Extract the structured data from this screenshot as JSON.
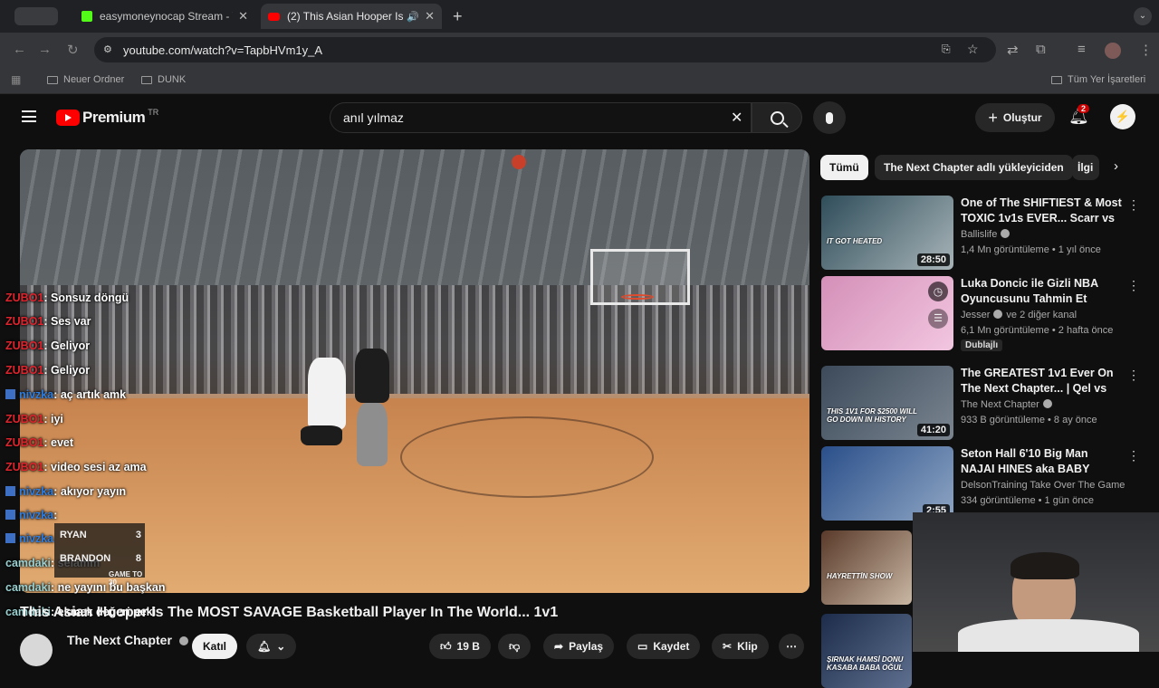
{
  "browser": {
    "tabs": [
      {
        "label": "easymoneynocap Stream - W",
        "icon_color": "#53fc18"
      },
      {
        "label": "(2) This Asian Hooper Is T",
        "icon_color": "#ff0000"
      }
    ],
    "url": "youtube.com/watch?v=TapbHVm1y_A",
    "bookmarks": [
      "Neuer Ordner",
      "DUNK"
    ],
    "all_bookmarks": "Tüm Yer İşaretleri"
  },
  "youtube": {
    "logo": "Premium",
    "logo_region": "TR",
    "search_value": "anıl yılmaz",
    "create_label": "Oluştur",
    "notification_count": "2"
  },
  "chat": [
    {
      "user": "ZUBO1",
      "type": "zubo",
      "text": ": Sonsuz döngü"
    },
    {
      "user": "ZUBO1",
      "type": "zubo",
      "text": ": Ses var"
    },
    {
      "user": "ZUBO1",
      "type": "zubo",
      "text": ": Geliyor"
    },
    {
      "user": "ZUBO1",
      "type": "zubo",
      "text": ": Geliyor"
    },
    {
      "user": "nivzka",
      "type": "niv",
      "text": ": aç artık amk"
    },
    {
      "user": "ZUBO1",
      "type": "zubo",
      "text": ": iyi"
    },
    {
      "user": "ZUBO1",
      "type": "zubo",
      "text": ": evet"
    },
    {
      "user": "ZUBO1",
      "type": "zubo",
      "text": ": video sesi az ama"
    },
    {
      "user": "nivzka",
      "type": "niv",
      "text": ": akıyor yayın"
    },
    {
      "user": "nivzka",
      "type": "niv",
      "text": ":"
    },
    {
      "user": "nivzka",
      "type": "niv",
      "text": ""
    },
    {
      "user": "camdaki",
      "type": "cam",
      "text": ": selamm"
    },
    {
      "user": "camdaki",
      "type": "cam",
      "text": ": ne yayını bu başkan"
    },
    {
      "user": "camdaki",
      "type": "cam",
      "text": ": ekmek değeri peki"
    }
  ],
  "scoreboard": {
    "p1": "RYAN",
    "s1": "3",
    "p2": "BRANDON",
    "s2": "8",
    "label": "GAME TO 30"
  },
  "video": {
    "title": "This Asian Hooper Is The MOST SAVAGE Basketball Player In The World... 1v1",
    "channel": "The Next Chapter",
    "join_label": "Katıl",
    "likes": "19 B",
    "share": "Paylaş",
    "save": "Kaydet",
    "clip": "Klip"
  },
  "chips": [
    "Tümü",
    "The Next Chapter adlı yükleyiciden",
    "İlgi"
  ],
  "recommendations": [
    {
      "title": "One of The SHIFTIEST & Most TOXIC 1v1s EVER... Scarr vs ...",
      "channel": "Ballislife",
      "meta": "1,4 Mn görüntüleme • 1 yıl önce",
      "duration": "28:50",
      "thumb_text": "IT GOT HEATED",
      "c1": "#2f4d5a",
      "c2": "#a7b4b8"
    },
    {
      "title": "Luka Doncic ile Gizli NBA Oyuncusunu Tahmin Et",
      "channel": "Jesser",
      "channel_extra": "ve 2 diğer kanal",
      "meta": "6,1 Mn görüntüleme • 2 hafta önce",
      "badge": "Dublajlı",
      "duration": "",
      "thumb_text": "",
      "c1": "#d48fb8",
      "c2": "#f2c6e0"
    },
    {
      "title": "The GREATEST 1v1 Ever On The Next Chapter... | Qel vs Patt Fo...",
      "channel": "The Next Chapter",
      "meta": "933 B görüntüleme • 8 ay önce",
      "duration": "41:20",
      "thumb_text": "THIS 1V1 FOR $2500 WILL GO DOWN IN HISTORY",
      "c1": "#3c4a5a",
      "c2": "#7a8590"
    },
    {
      "title": "Seton Hall 6'10 Big Man NAJAI HINES aka BABY SHAQ Is A ...",
      "channel": "DelsonTraining Take Over The Game",
      "meta": "334 görüntüleme • 1 gün önce",
      "duration": "2:55",
      "thumb_text": "",
      "c1": "#2a4f8a",
      "c2": "#8fa6c4"
    },
    {
      "title": "",
      "channel": "",
      "meta": "",
      "duration": "",
      "thumb_text": "HAYRETTİN SHOW",
      "c1": "#5a3a2a",
      "c2": "#c9b7a3"
    },
    {
      "title": "",
      "channel": "",
      "meta": "",
      "duration": "",
      "thumb_text": "ŞIRNAK HAMSİ DONU KASABA BABA OĞUL",
      "c1": "#1c2c4a",
      "c2": "#5f6f8f"
    }
  ],
  "colors": {
    "yt_red": "#ff0000",
    "bg": "#0f0f0f",
    "chip_bg": "#272727"
  }
}
